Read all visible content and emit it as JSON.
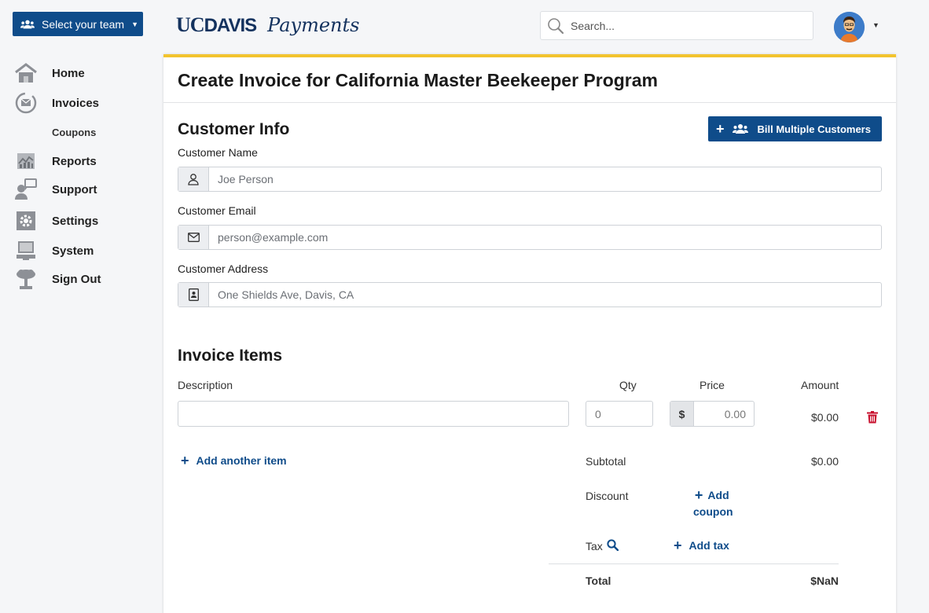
{
  "header": {
    "team_button_label": "Select your team",
    "logo_uc": "UC",
    "logo_davis": "DAVIS",
    "logo_product": "Payments",
    "search_placeholder": "Search..."
  },
  "sidebar": {
    "items": [
      {
        "label": "Home",
        "icon": "home-icon"
      },
      {
        "label": "Invoices",
        "icon": "invoices-icon"
      },
      {
        "label": "Coupons",
        "icon": ""
      },
      {
        "label": "Reports",
        "icon": "reports-icon"
      },
      {
        "label": "Support",
        "icon": "support-icon"
      },
      {
        "label": "Settings",
        "icon": "settings-icon"
      },
      {
        "label": "System",
        "icon": "system-icon"
      },
      {
        "label": "Sign Out",
        "icon": "sign-out-icon"
      }
    ]
  },
  "main": {
    "title": "Create Invoice for California Master Beekeeper Program",
    "customer_info": {
      "heading": "Customer Info",
      "bill_multiple_label": "Bill Multiple Customers",
      "name_label": "Customer Name",
      "name_placeholder": "Joe Person",
      "email_label": "Customer Email",
      "email_placeholder": "person@example.com",
      "address_label": "Customer Address",
      "address_placeholder": "One Shields Ave, Davis, CA"
    },
    "invoice_items": {
      "heading": "Invoice Items",
      "columns": {
        "description": "Description",
        "qty": "Qty",
        "price": "Price",
        "amount": "Amount"
      },
      "row": {
        "description": "",
        "qty": "0",
        "currency": "$",
        "price": "0.00",
        "amount": "$0.00"
      },
      "add_item_label": "Add another item"
    },
    "summary": {
      "subtotal_label": "Subtotal",
      "subtotal_value": "$0.00",
      "discount_label": "Discount",
      "add_coupon_line1": "Add",
      "add_coupon_line2": "coupon",
      "tax_label": "Tax",
      "add_tax_label": "Add tax",
      "total_label": "Total",
      "total_value": "$NaN"
    }
  },
  "colors": {
    "primary": "#0f4c8a",
    "accent": "#f2c32e",
    "danger": "#c8102e"
  }
}
